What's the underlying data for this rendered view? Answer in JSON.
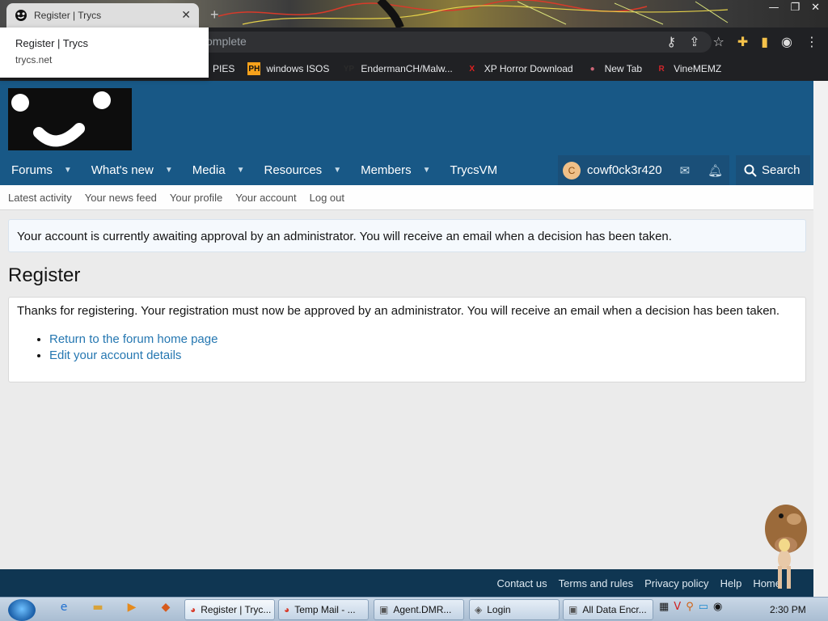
{
  "browser": {
    "tab_title": "Register | Trycs",
    "tab_close": "✕",
    "new_tab": "+",
    "omnibox_text": "omplete",
    "tooltip_title": "Register | Trycs",
    "tooltip_url": "trycs.net",
    "bookmarks": [
      {
        "label": "PIES",
        "icon": "folder-icon",
        "color": "#f5c24a",
        "glyph": ""
      },
      {
        "label": "windows ISOS",
        "icon": "ph-icon",
        "color": "#f7a21b",
        "glyph": "PH"
      },
      {
        "label": "EndermanCH/Malw...",
        "icon": "yp-icon",
        "color": "#2b2b2b",
        "glyph": "YP"
      },
      {
        "label": "XP Horror Download",
        "icon": "x-icon",
        "color": "#e02020",
        "glyph": "X"
      },
      {
        "label": "New Tab",
        "icon": "globe-icon",
        "color": "#cc6677",
        "glyph": "●"
      },
      {
        "label": "VineMEMZ",
        "icon": "r-icon",
        "color": "#d0262b",
        "glyph": "R"
      }
    ]
  },
  "site": {
    "nav": [
      {
        "label": "Forums",
        "caret": true
      },
      {
        "label": "What's new",
        "caret": true
      },
      {
        "label": "Media",
        "caret": true
      },
      {
        "label": "Resources",
        "caret": true
      },
      {
        "label": "Members",
        "caret": true
      },
      {
        "label": "TrycsVM",
        "caret": false
      }
    ],
    "username": "cowf0ck3r420",
    "avatar_letter": "C",
    "search_label": "Search",
    "subnav": [
      "Latest activity",
      "Your news feed",
      "Your profile",
      "Your account",
      "Log out"
    ]
  },
  "content": {
    "notice": "Your account is currently awaiting approval by an administrator. You will receive an email when a decision has been taken.",
    "title": "Register",
    "message": "Thanks for registering. Your registration must now be approved by an administrator. You will receive an email when a decision has been taken.",
    "links": [
      "Return to the forum home page",
      "Edit your account details"
    ]
  },
  "footer": {
    "links": [
      "Contact us",
      "Terms and rules",
      "Privacy policy",
      "Help",
      "Home"
    ]
  },
  "taskbar": {
    "tasks": [
      {
        "label": "Register | Tryc...",
        "icon": "chrome-icon",
        "active": true
      },
      {
        "label": "Temp Mail - ...",
        "icon": "chrome-icon",
        "active": false
      },
      {
        "label": "Agent.DMR...",
        "icon": "window-icon",
        "active": false
      },
      {
        "label": "Login",
        "icon": "app-icon",
        "active": false
      },
      {
        "label": "All Data Encr...",
        "icon": "window-icon",
        "active": false
      }
    ],
    "clock": "2:30 PM"
  },
  "colors": {
    "header": "#185886",
    "link": "#2577b1",
    "footer": "#0f3652"
  }
}
